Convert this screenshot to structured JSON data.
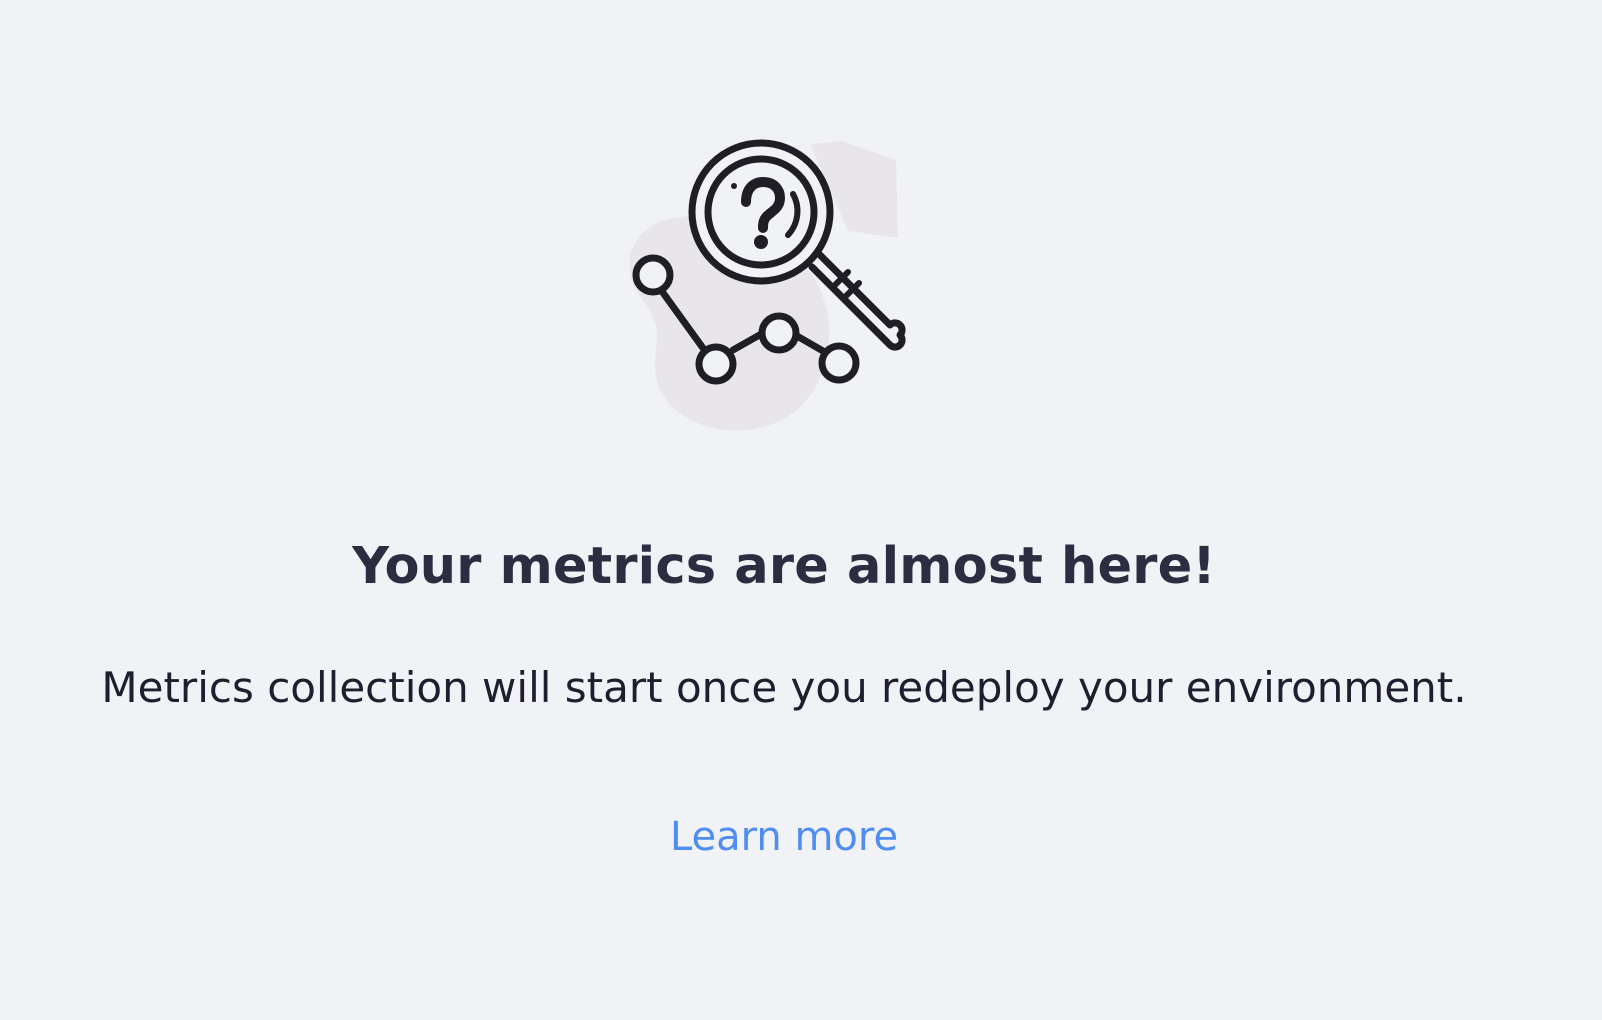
{
  "empty_state": {
    "illustration_icon": "magnifier-question-chart-icon",
    "title": "Your metrics are almost here!",
    "description": "Metrics collection will start once you redeploy your environment.",
    "learn_more_label": "Learn more"
  },
  "colors": {
    "background": "#f1f2f5",
    "title": "#2d2c40",
    "body_text": "#1f1e2e",
    "link": "#4f8ef0",
    "icon_stroke": "#1e1e24",
    "icon_blob": "#e8e6e8"
  }
}
